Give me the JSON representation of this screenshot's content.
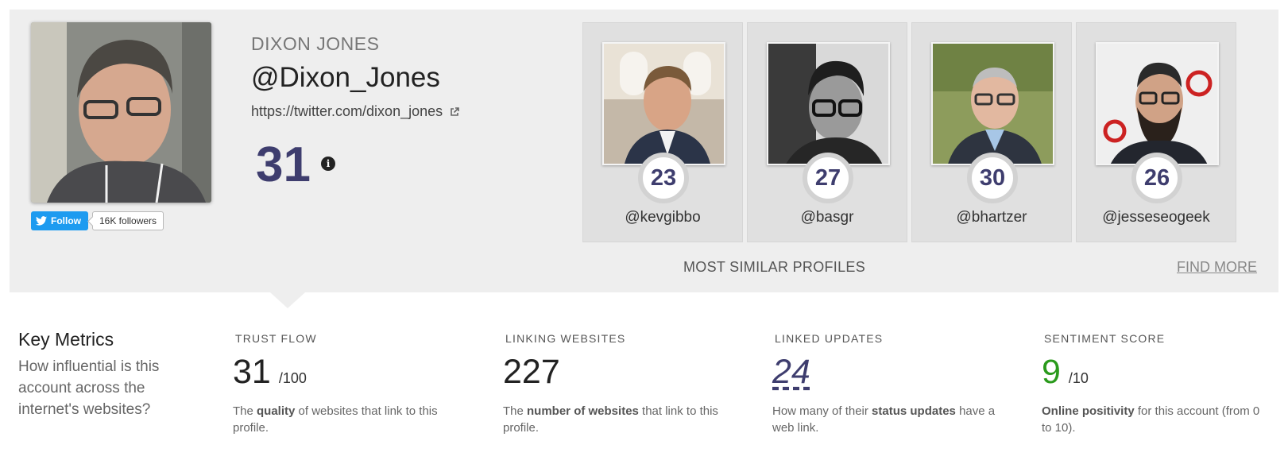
{
  "profile": {
    "display_name": "DIXON JONES",
    "handle": "@Dixon_Jones",
    "url": "https://twitter.com/dixon_jones",
    "score": "31",
    "follow_label": "Follow",
    "followers": "16K followers"
  },
  "similar": {
    "title": "MOST SIMILAR PROFILES",
    "find_more": "FIND MORE",
    "profiles": [
      {
        "handle": "@kevgibbo",
        "score": "23"
      },
      {
        "handle": "@basgr",
        "score": "27"
      },
      {
        "handle": "@bhartzer",
        "score": "30"
      },
      {
        "handle": "@jesseseogeek",
        "score": "26"
      }
    ]
  },
  "key_metrics": {
    "title": "Key Metrics",
    "subtitle": "How influential is this account across the internet's websites?",
    "metrics": [
      {
        "label": "TRUST FLOW",
        "value": "31",
        "suffix": "/100",
        "desc_pre": "The ",
        "desc_bold": "quality",
        "desc_post": " of websites that link to this profile."
      },
      {
        "label": "LINKING WEBSITES",
        "value": "227",
        "suffix": "",
        "desc_pre": "The ",
        "desc_bold": "number of websites",
        "desc_post": " that link to this profile."
      },
      {
        "label": "LINKED UPDATES",
        "value": "24",
        "suffix": "",
        "desc_pre": "How many of their ",
        "desc_bold": "status updates",
        "desc_post": " have a web link."
      },
      {
        "label": "SENTIMENT SCORE",
        "value": "9",
        "suffix": "/10",
        "desc_pre": "",
        "desc_bold": "Online positivity",
        "desc_post": " for this account (from 0 to 10)."
      }
    ]
  },
  "colors": {
    "accent": "#3e3d6e",
    "twitter_blue": "#1d9bf0",
    "positive_green": "#2a9a1c",
    "panel_bg": "#eeeeee"
  }
}
